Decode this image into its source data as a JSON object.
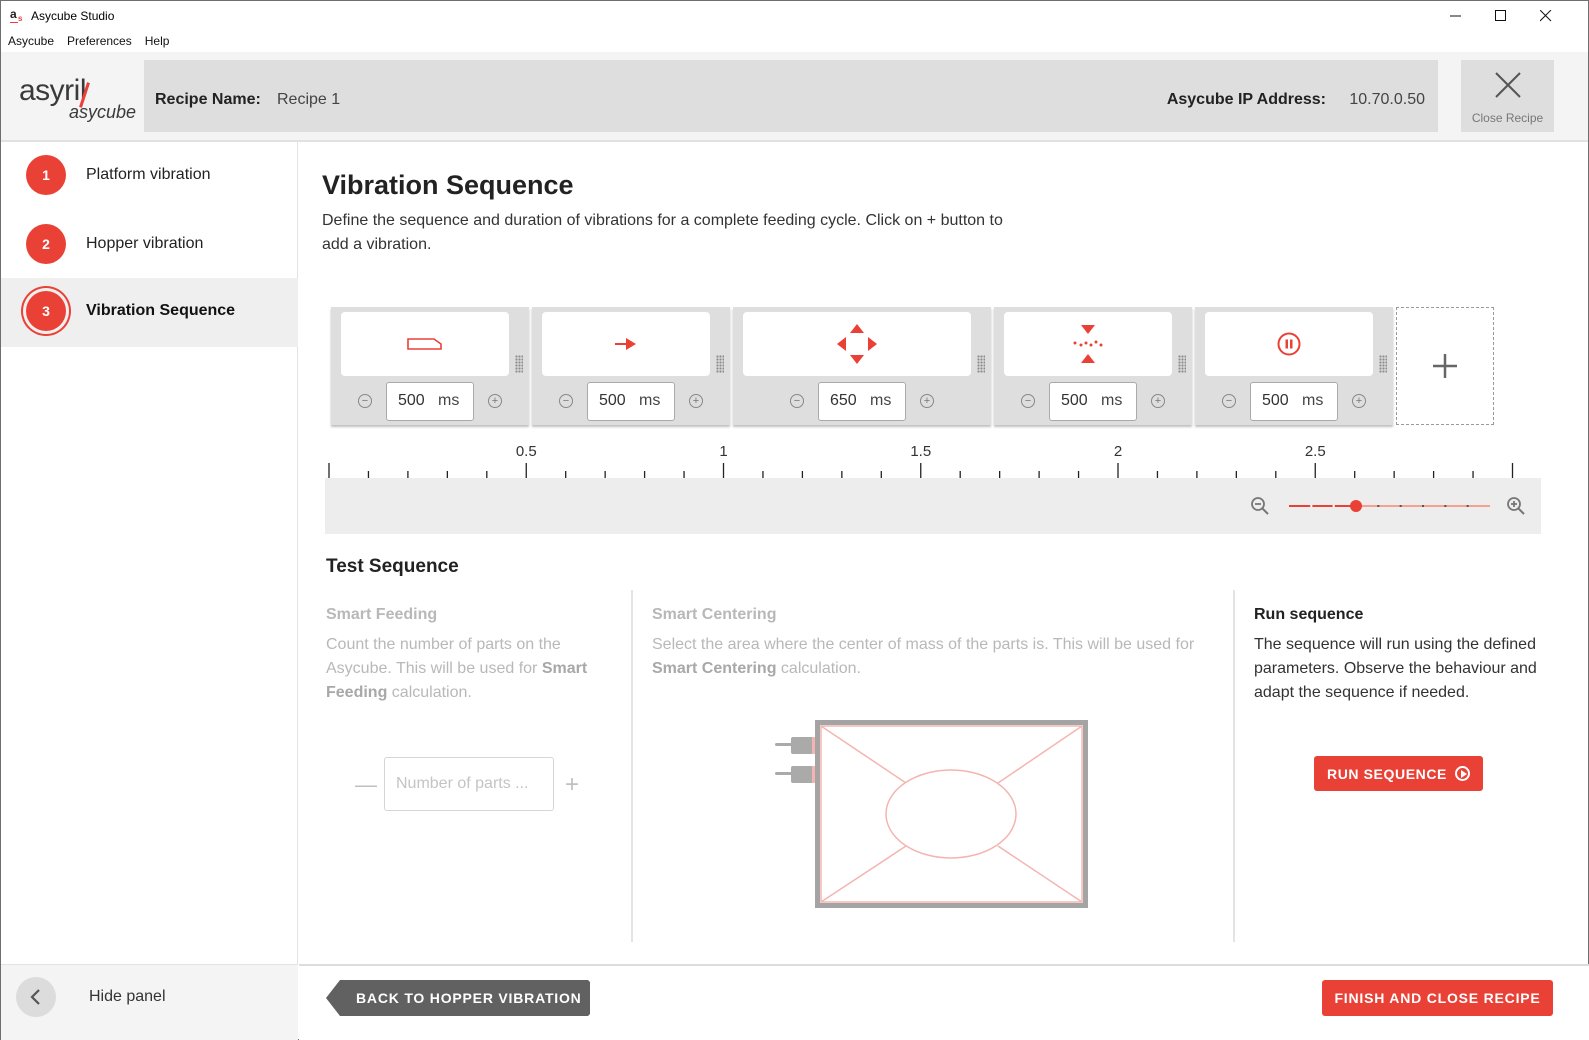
{
  "window": {
    "title": "Asycube Studio",
    "controls": {
      "minimize": "—",
      "maximize": "☐",
      "close": "✕"
    }
  },
  "menubar": [
    "Asycube",
    "Preferences",
    "Help"
  ],
  "header": {
    "logo_top": "asyril",
    "logo_bottom": "asycube",
    "recipe_label": "Recipe Name:",
    "recipe_value": "Recipe 1",
    "ip_label": "Asycube IP Address:",
    "ip_value": "10.70.0.50",
    "close_recipe_label": "Close Recipe"
  },
  "sidebar": {
    "steps": [
      {
        "number": "1",
        "label": "Platform vibration",
        "active": false
      },
      {
        "number": "2",
        "label": "Hopper vibration",
        "active": false
      },
      {
        "number": "3",
        "label": "Vibration Sequence",
        "active": true
      }
    ],
    "hide_panel_label": "Hide panel"
  },
  "main": {
    "title": "Vibration Sequence",
    "description": "Define the sequence and duration of vibrations for a complete feeding cycle. Click on + button to add a vibration.",
    "sequence": [
      {
        "icon": "hopper-icon",
        "duration": "500",
        "unit": "ms"
      },
      {
        "icon": "arrow-right-icon",
        "duration": "500",
        "unit": "ms"
      },
      {
        "icon": "spread-arrows-icon",
        "duration": "650",
        "unit": "ms"
      },
      {
        "icon": "center-line-icon",
        "duration": "500",
        "unit": "ms"
      },
      {
        "icon": "pause-icon",
        "duration": "500",
        "unit": "ms"
      }
    ],
    "add_label": "+",
    "timeline": {
      "tick_labels": [
        "0.5",
        "1",
        "1.5",
        "2",
        "2.5"
      ],
      "zoom_level_fraction": 0.33
    },
    "test": {
      "title": "Test Sequence",
      "smart_feeding": {
        "title": "Smart Feeding",
        "text_before": "Count the number of parts on the Asycube. This will be used for ",
        "text_bold": "Smart Feeding",
        "text_after": " calculation.",
        "input_placeholder": "Number of parts ...",
        "minus": "—",
        "plus": "+"
      },
      "smart_centering": {
        "title": "Smart Centering",
        "text_before": "Select the area where the center of mass of the parts is. This will be used for ",
        "text_bold": "Smart Centering",
        "text_after": " calculation."
      },
      "run": {
        "title": "Run sequence",
        "text": "The sequence will run using the defined parameters. Observe the behaviour and adapt the sequence if needed.",
        "button": "RUN SEQUENCE"
      }
    }
  },
  "footer": {
    "back_label": "BACK TO HOPPER VIBRATION",
    "finish_label": "FINISH AND CLOSE RECIPE"
  },
  "colors": {
    "accent": "#ea4137",
    "dark_button": "#616161",
    "header_bar": "#dedede"
  }
}
